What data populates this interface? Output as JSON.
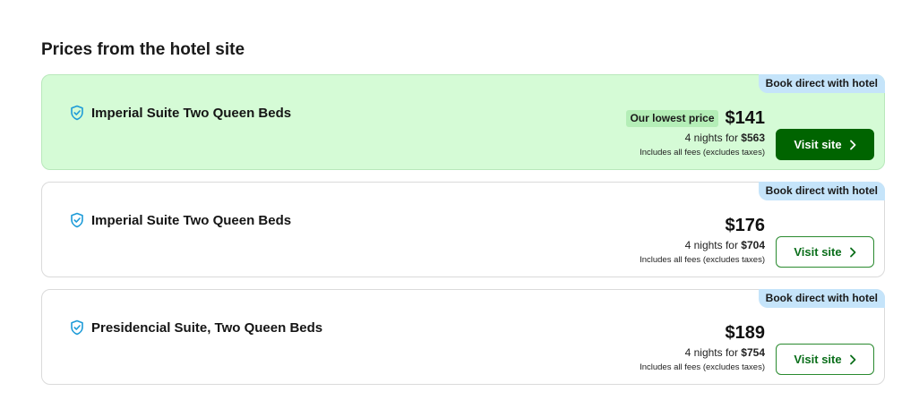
{
  "section_title": "Prices from the hotel site",
  "colors": {
    "best_background": "#d5fbd6",
    "badge_background": "#c5e4fa",
    "primary_button": "#006400",
    "shield_icon": "#1d9bd8"
  },
  "offers": [
    {
      "badge": "Book direct with hotel",
      "room_name": "Imperial Suite Two Queen Beds",
      "lowest_tag": "Our lowest price",
      "price": "$141",
      "nights_prefix": "4 nights for ",
      "total": "$563",
      "fees_note": "Includes all fees (excludes taxes)",
      "button_label": "Visit site",
      "icon": "shield-check-icon"
    },
    {
      "badge": "Book direct with hotel",
      "room_name": "Imperial Suite Two Queen Beds",
      "price": "$176",
      "nights_prefix": "4 nights for ",
      "total": "$704",
      "fees_note": "Includes all fees (excludes taxes)",
      "button_label": "Visit site",
      "icon": "shield-check-icon"
    },
    {
      "badge": "Book direct with hotel",
      "room_name": "Presidencial Suite, Two Queen Beds",
      "price": "$189",
      "nights_prefix": "4 nights for ",
      "total": "$754",
      "fees_note": "Includes all fees (excludes taxes)",
      "button_label": "Visit site",
      "icon": "shield-check-icon"
    }
  ]
}
